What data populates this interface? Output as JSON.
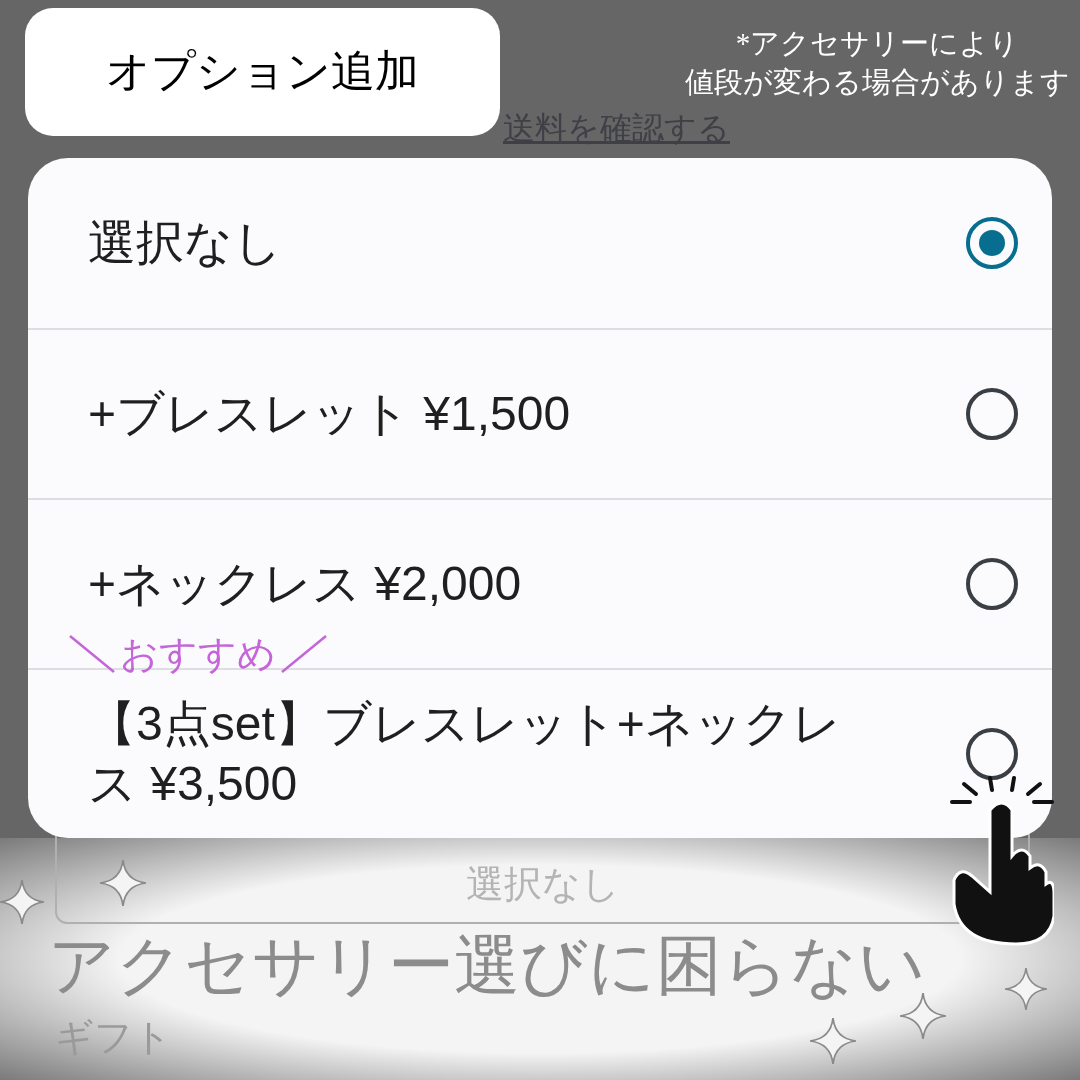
{
  "header": {
    "title": "オプション追加",
    "note_lines": [
      "*アクセサリーにより",
      "値段が変わる場合があります"
    ]
  },
  "background_link": "送料を確認する",
  "options": [
    {
      "label": "選択なし",
      "selected": true
    },
    {
      "label": "+ブレスレット ¥1,500",
      "selected": false
    },
    {
      "label": "+ネックレス ¥2,000",
      "selected": false
    },
    {
      "label": "【3点set】ブレスレット+ネックレス ¥3,500",
      "selected": false,
      "badge": "おすすめ"
    }
  ],
  "background_select": {
    "value": "選択なし"
  },
  "promo_text": "アクセサリー選びに困らない",
  "background_label": "ギフト"
}
